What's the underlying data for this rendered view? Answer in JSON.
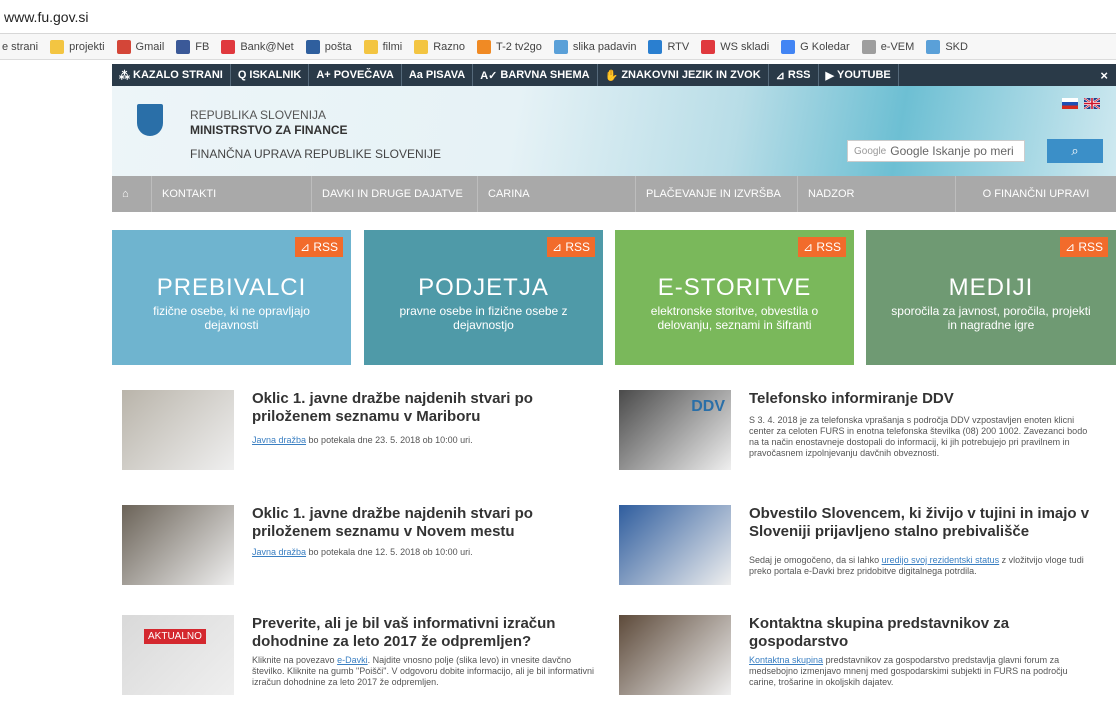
{
  "browser": {
    "url": "www.fu.gov.si"
  },
  "bookmarks": [
    {
      "label": "e strani",
      "color": "#ffffff"
    },
    {
      "label": "projekti",
      "color": "#f3c542"
    },
    {
      "label": "Gmail",
      "color": "#d44638"
    },
    {
      "label": "FB",
      "color": "#3b5998"
    },
    {
      "label": "Bank@Net",
      "color": "#e0393e"
    },
    {
      "label": "pošta",
      "color": "#2f5f9e"
    },
    {
      "label": "filmi",
      "color": "#f3c542"
    },
    {
      "label": "Razno",
      "color": "#f3c542"
    },
    {
      "label": "T-2 tv2go",
      "color": "#f08a24"
    },
    {
      "label": "slika padavin",
      "color": "#5aa0d8"
    },
    {
      "label": "RTV",
      "color": "#2a7fd0"
    },
    {
      "label": "WS skladi",
      "color": "#e0393e"
    },
    {
      "label": "G Koledar",
      "color": "#4285f4"
    },
    {
      "label": "e-VEM",
      "color": "#9e9e9e"
    },
    {
      "label": "SKD",
      "color": "#5aa0d8"
    }
  ],
  "accessibility": [
    {
      "label": "KAZALO STRANI",
      "icon": "⁂"
    },
    {
      "label": "ISKALNIK",
      "icon": "Q"
    },
    {
      "label": "POVEČAVA",
      "icon": "A+"
    },
    {
      "label": "PISAVA",
      "icon": "Aa"
    },
    {
      "label": "BARVNA SHEMA",
      "icon": "A✓"
    },
    {
      "label": "ZNAKOVNI JEZIK IN ZVOK",
      "icon": "✋"
    },
    {
      "label": "RSS",
      "icon": "⊿"
    },
    {
      "label": "YOUTUBE",
      "icon": "▶"
    }
  ],
  "close": "×",
  "header": {
    "line1": "REPUBLIKA SLOVENIJA",
    "line2": "MINISTRSTVO ZA FINANCE",
    "line3": "FINANČNA UPRAVA REPUBLIKE SLOVENIJE",
    "search_brand": "Google",
    "search_placeholder": "Google Iskanje po meri",
    "search_icon": "⌕"
  },
  "nav": [
    {
      "label": "⌂"
    },
    {
      "label": "KONTAKTI"
    },
    {
      "label": "DAVKI IN DRUGE DAJATVE"
    },
    {
      "label": "CARINA"
    },
    {
      "label": "PLAČEVANJE IN IZVRŠBA"
    },
    {
      "label": "NADZOR"
    },
    {
      "label": "O FINANČNI UPRAVI"
    }
  ],
  "tiles": [
    {
      "title": "PREBIVALCI",
      "subtitle": "fizične osebe, ki ne opravljajo dejavnosti",
      "rss": "RSS",
      "bg": "#6fb4cf"
    },
    {
      "title": "PODJETJA",
      "subtitle": "pravne osebe in fizične osebe z dejavnostjo",
      "rss": "RSS",
      "bg": "#4f9aa8"
    },
    {
      "title": "E-STORITVE",
      "subtitle": "elektronske storitve, obvestila o delovanju, seznami in šifranti",
      "rss": "RSS",
      "bg": "#7ab85b"
    },
    {
      "title": "MEDIJI",
      "subtitle": "sporočila za javnost, poročila, projekti in nagradne igre",
      "rss": "RSS",
      "bg": "#6f9a73"
    }
  ],
  "news": [
    {
      "title": "Oklic 1. javne dražbe najdenih stvari po priloženem seznamu v Mariboru",
      "link": "Javna dražba",
      "text": " bo potekala dne 23. 5. 2018 ob 10:00 uri."
    },
    {
      "title": "Telefonsko informiranje DDV",
      "link": "",
      "text": "S 3. 4. 2018 je za telefonska vprašanja s področja DDV vzpostavljen enoten klicni center za celoten FURS in enotna telefonska številka (08) 200 1002. Zavezanci bodo na ta način enostavneje dostopali do informacij, ki jih potrebujejo pri pravilnem in pravočasnem izpolnjevanju davčnih obveznosti."
    },
    {
      "title": "Oklic 1. javne dražbe najdenih stvari po priloženem seznamu v Novem mestu",
      "link": "Javna dražba",
      "text": " bo potekala dne 12. 5. 2018 ob 10:00 uri."
    },
    {
      "title": "Obvestilo Slovencem, ki živijo v tujini in imajo v Sloveniji prijavljeno stalno prebivališče",
      "link": "uredijo svoj rezidentski status",
      "text_before": "Sedaj je omogočeno, da si lahko ",
      "text": " z vložitvijo vloge tudi preko portala e-Davki brez pridobitve digitalnega potrdila."
    },
    {
      "title": "Preverite, ali je bil vaš informativni izračun dohodnine za leto 2017 že odpremljen?",
      "link": "e-Davki",
      "text_before": "Kliknite na povezavo ",
      "text": ". Najdite vnosno polje (slika levo) in vnesite davčno številko. Kliknite na gumb \"Poišči\". V odgovoru dobite informacijo, ali je bil informativni izračun dohodnine za leto 2017 že odpremljen."
    },
    {
      "title": "Kontaktna skupina predstavnikov za gospodarstvo",
      "link": "Kontaktna skupina",
      "text": " predstavnikov za gospodarstvo predstavlja glavni forum za medsebojno izmenjavo mnenj med gospodarskimi subjekti in FURS na področju carine, trošarine in okoljskih dajatev."
    }
  ],
  "aktualno_badge": "AKTUALNO",
  "ddv_label": "DDV"
}
